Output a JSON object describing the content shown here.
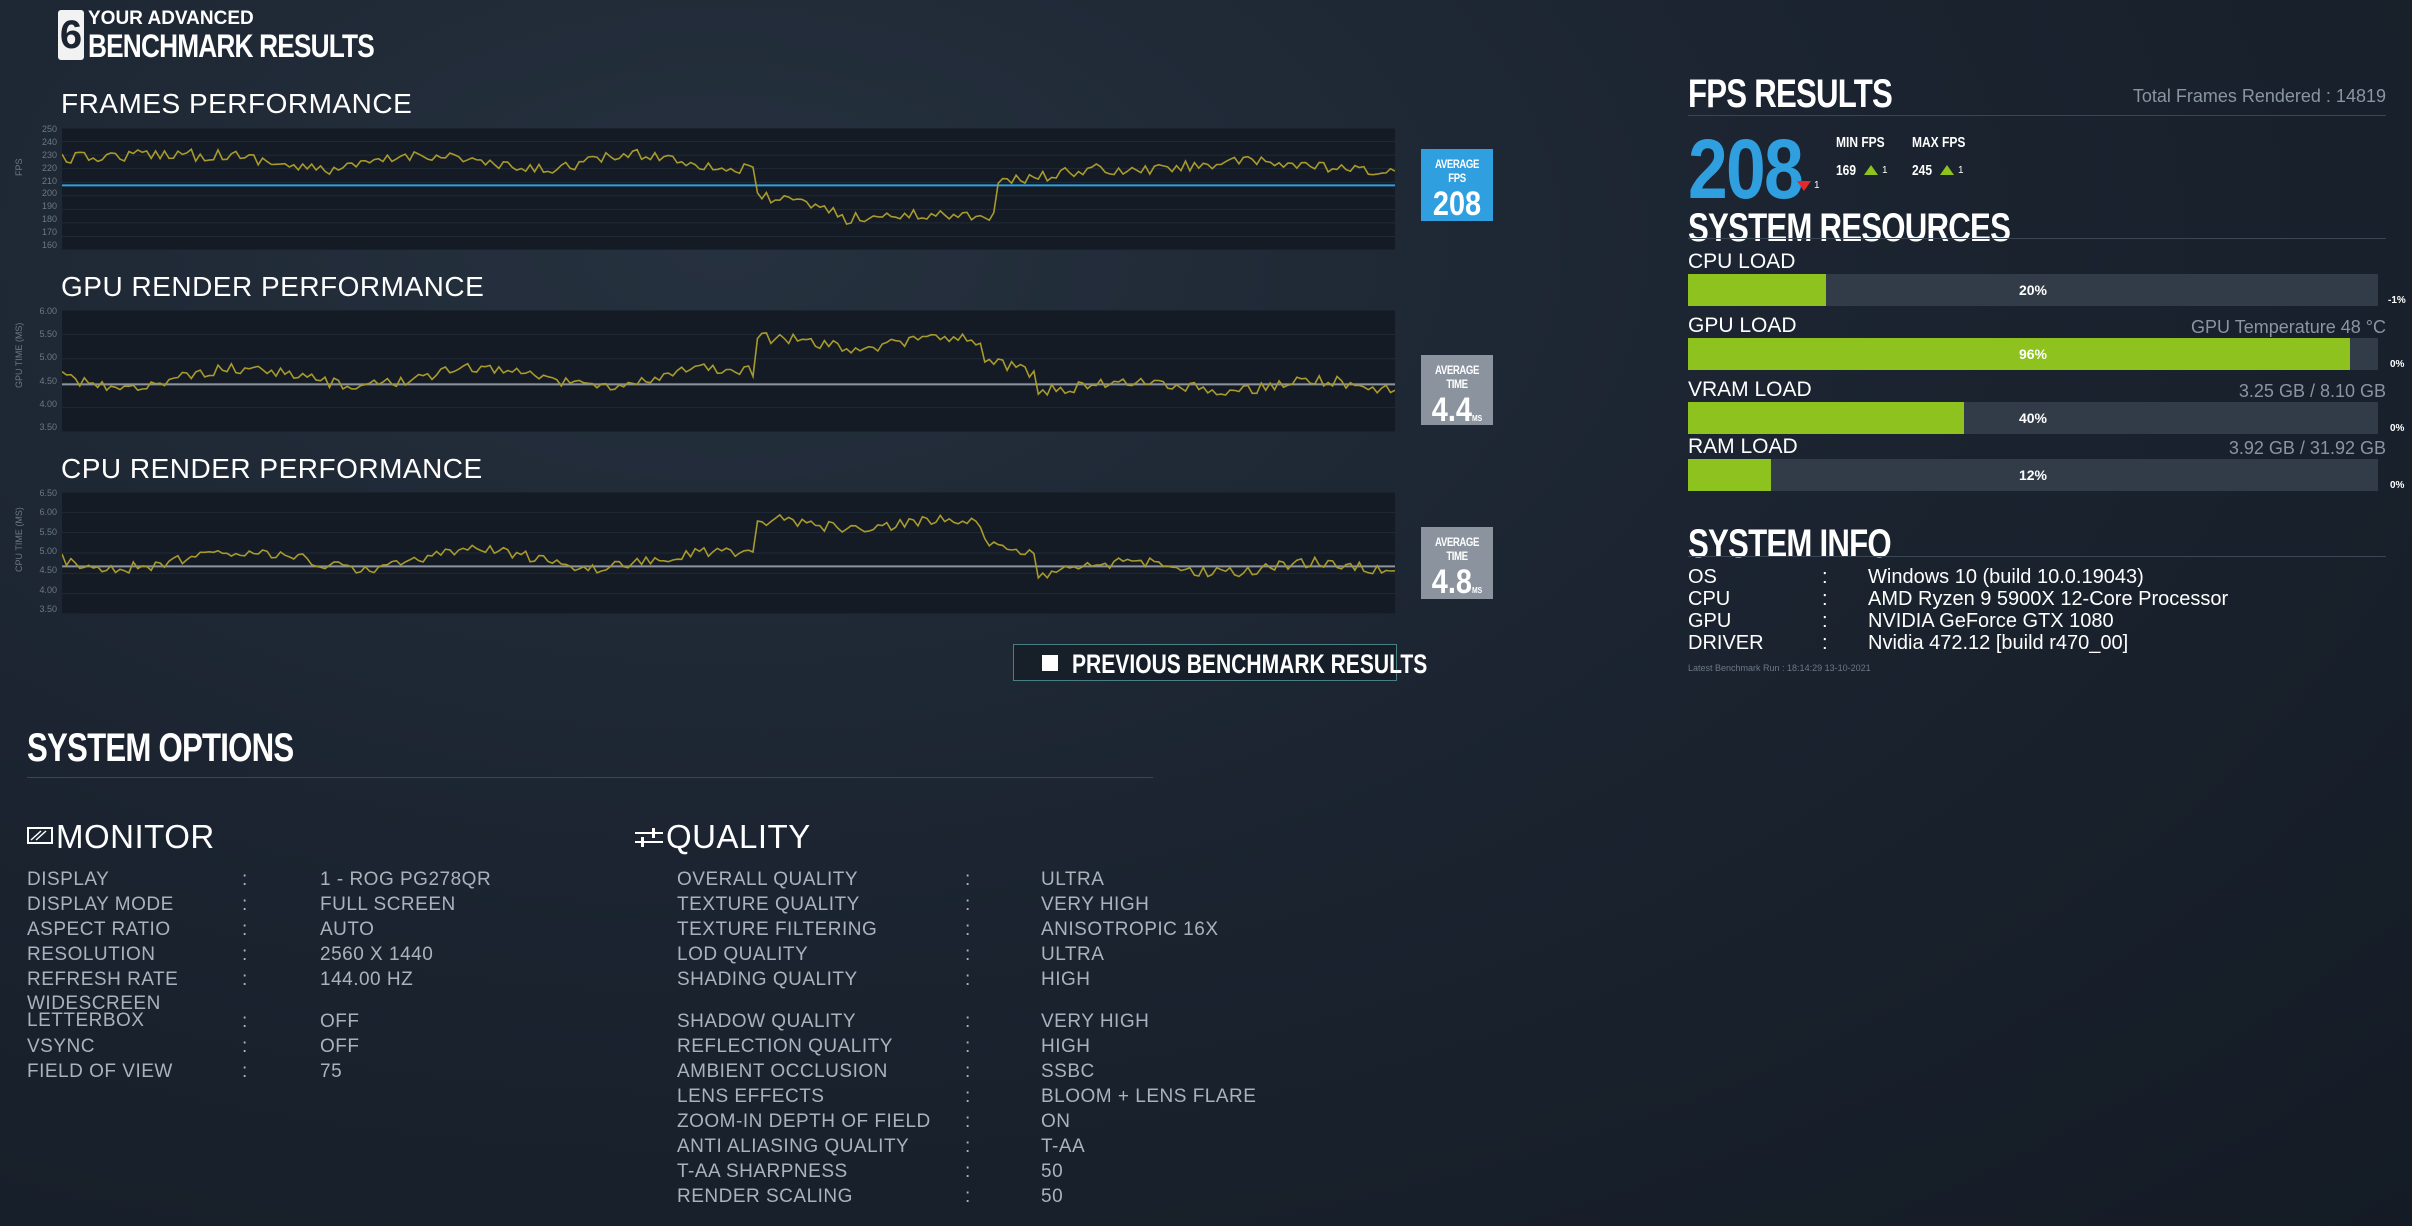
{
  "header": {
    "logo_glyph": "6",
    "line1": "YOUR ADVANCED",
    "line2": "BENCHMARK RESULTS"
  },
  "graphs": {
    "frames": {
      "title": "FRAMES PERFORMANCE",
      "yaxis": "FPS",
      "ticks": [
        "250",
        "240",
        "230",
        "220",
        "210",
        "200",
        "190",
        "180",
        "170",
        "160"
      ],
      "avg_label": "AVERAGE FPS",
      "avg_value": "208",
      "avg_unit": "",
      "avg_color": "#2f9fe0"
    },
    "gpu": {
      "title": "GPU RENDER PERFORMANCE",
      "yaxis": "GPU TIME (MS)",
      "ticks": [
        "6.00",
        "5.50",
        "5.00",
        "4.50",
        "4.00",
        "3.50"
      ],
      "avg_label": "AVERAGE TIME",
      "avg_value": "4.4",
      "avg_unit": "MS",
      "avg_color": "#8b949e"
    },
    "cpu": {
      "title": "CPU RENDER PERFORMANCE",
      "yaxis": "CPU TIME (MS)",
      "ticks": [
        "6.50",
        "6.00",
        "5.50",
        "5.00",
        "4.50",
        "4.00",
        "3.50"
      ],
      "avg_label": "AVERAGE TIME",
      "avg_value": "4.8",
      "avg_unit": "MS",
      "avg_color": "#8b949e"
    }
  },
  "previous_button": {
    "label": "PREVIOUS BENCHMARK RESULTS"
  },
  "fps_results": {
    "title": "FPS RESULTS",
    "total_frames": "Total Frames Rendered : 14819",
    "average": "208",
    "average_delta": "1",
    "min_label": "MIN FPS",
    "min_value": "169",
    "min_delta": "1",
    "max_label": "MAX FPS",
    "max_value": "245",
    "max_delta": "1"
  },
  "system_resources": {
    "title": "SYSTEM RESOURCES",
    "items": [
      {
        "label": "CPU LOAD",
        "right": "",
        "percent": 20,
        "pct_text": "20%",
        "delta": "-1%"
      },
      {
        "label": "GPU LOAD",
        "right": "GPU Temperature 48 °C",
        "percent": 96,
        "pct_text": "96%",
        "delta": "0%"
      },
      {
        "label": "VRAM LOAD",
        "right": "3.25 GB / 8.10 GB",
        "percent": 40,
        "pct_text": "40%",
        "delta": "0%"
      },
      {
        "label": "RAM LOAD",
        "right": "3.92 GB / 31.92 GB",
        "percent": 12,
        "pct_text": "12%",
        "delta": "0%"
      }
    ]
  },
  "system_info": {
    "title": "SYSTEM INFO",
    "rows": [
      {
        "key": "OS",
        "sep": ":",
        "value": "Windows 10 (build 10.0.19043)"
      },
      {
        "key": "CPU",
        "sep": ":",
        "value": "AMD Ryzen 9 5900X 12-Core Processor"
      },
      {
        "key": "GPU",
        "sep": ":",
        "value": "NVIDIA GeForce GTX 1080"
      },
      {
        "key": "DRIVER",
        "sep": ":",
        "value": "Nvidia 472.12 [build r470_00]"
      }
    ],
    "latest_run": "Latest Benchmark Run : 18:14:29 13-10-2021"
  },
  "system_options": {
    "title": "SYSTEM OPTIONS",
    "monitor": {
      "title": "MONITOR",
      "rows": [
        {
          "key": "DISPLAY",
          "sep": ":",
          "value": "1 - ROG PG278QR"
        },
        {
          "key": "DISPLAY MODE",
          "sep": ":",
          "value": "FULL SCREEN"
        },
        {
          "key": "ASPECT RATIO",
          "sep": ":",
          "value": "AUTO"
        },
        {
          "key": "RESOLUTION",
          "sep": ":",
          "value": "2560 X 1440"
        },
        {
          "key": "REFRESH RATE",
          "sep": ":",
          "value": "144.00 HZ"
        },
        {
          "key": "WIDESCREEN LETTERBOX",
          "sep": ":",
          "value": "OFF"
        },
        {
          "key": "VSYNC",
          "sep": ":",
          "value": "OFF"
        },
        {
          "key": "FIELD OF VIEW",
          "sep": ":",
          "value": "75"
        }
      ]
    },
    "quality": {
      "title": "QUALITY",
      "rows": [
        {
          "key": "OVERALL QUALITY",
          "sep": ":",
          "value": "ULTRA"
        },
        {
          "key": "TEXTURE QUALITY",
          "sep": ":",
          "value": "VERY HIGH"
        },
        {
          "key": "TEXTURE FILTERING",
          "sep": ":",
          "value": "ANISOTROPIC 16X"
        },
        {
          "key": "LOD QUALITY",
          "sep": ":",
          "value": "ULTRA"
        },
        {
          "key": "SHADING QUALITY",
          "sep": ":",
          "value": "HIGH"
        },
        {
          "key": "SHADOW QUALITY",
          "sep": ":",
          "value": "VERY HIGH"
        },
        {
          "key": "REFLECTION QUALITY",
          "sep": ":",
          "value": "HIGH"
        },
        {
          "key": "AMBIENT OCCLUSION",
          "sep": ":",
          "value": "SSBC"
        },
        {
          "key": "LENS EFFECTS",
          "sep": ":",
          "value": "BLOOM + LENS FLARE"
        },
        {
          "key": "ZOOM-IN DEPTH OF FIELD",
          "sep": ":",
          "value": "ON"
        },
        {
          "key": "ANTI ALIASING QUALITY",
          "sep": ":",
          "value": "T-AA"
        },
        {
          "key": "T-AA SHARPNESS",
          "sep": ":",
          "value": "50"
        },
        {
          "key": "RENDER SCALING",
          "sep": ":",
          "value": "50"
        }
      ]
    }
  },
  "colors": {
    "accent_blue": "#2f9fe0",
    "accent_green": "#8dc21f",
    "line_olive": "#a89a2c",
    "down_red": "#e22a2a"
  }
}
